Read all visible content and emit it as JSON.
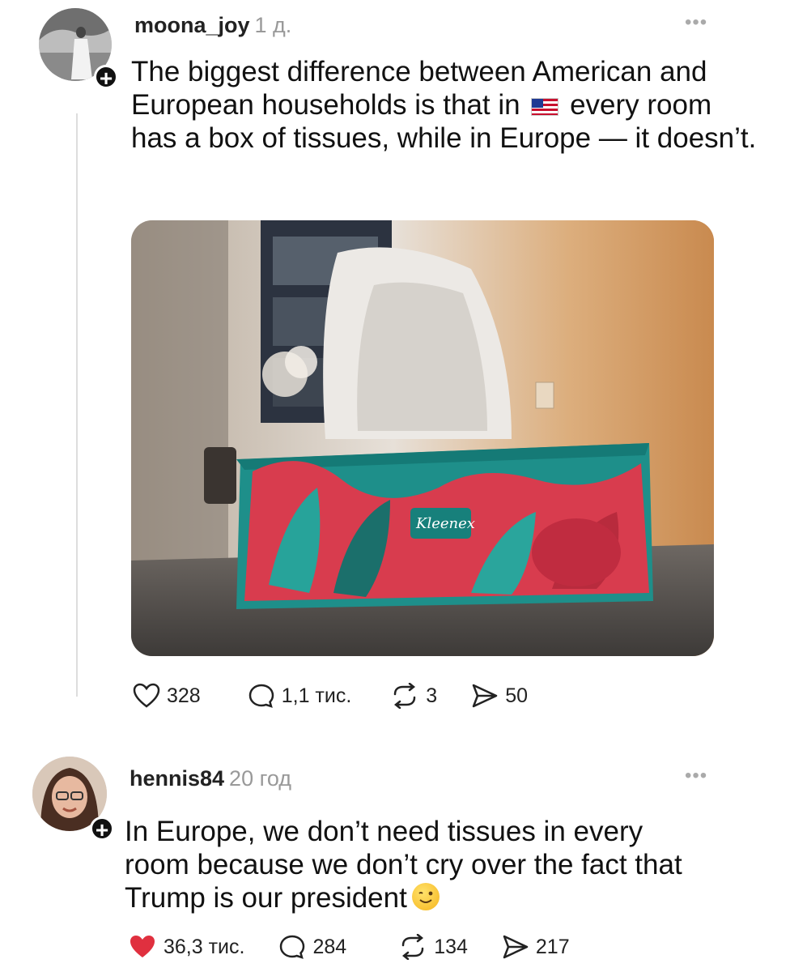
{
  "post": {
    "username": "moona_joy",
    "time": "1 д.",
    "more_icon": "more-icon",
    "text_before_flag": "The biggest difference between American and European households is that in ",
    "flag": "us-flag-emoji",
    "text_after_flag": " every room has a box of tissues, while in Europe — it doesn’t.",
    "image_brand": "Kleenex",
    "likes": "328",
    "comments": "1,1 тис.",
    "reposts": "3",
    "shares": "50"
  },
  "reply": {
    "username": "hennis84",
    "time": "20 год",
    "text": "In Europe, we don’t need tissues in every room because we don’t cry over the fact that Trump is our president",
    "emoji": "winking-face-emoji",
    "likes": "36,3 тис.",
    "comments": "284",
    "reposts": "134",
    "shares": "217"
  },
  "colors": {
    "like_active": "#e0303f",
    "muted": "#999999",
    "text": "#111111"
  }
}
